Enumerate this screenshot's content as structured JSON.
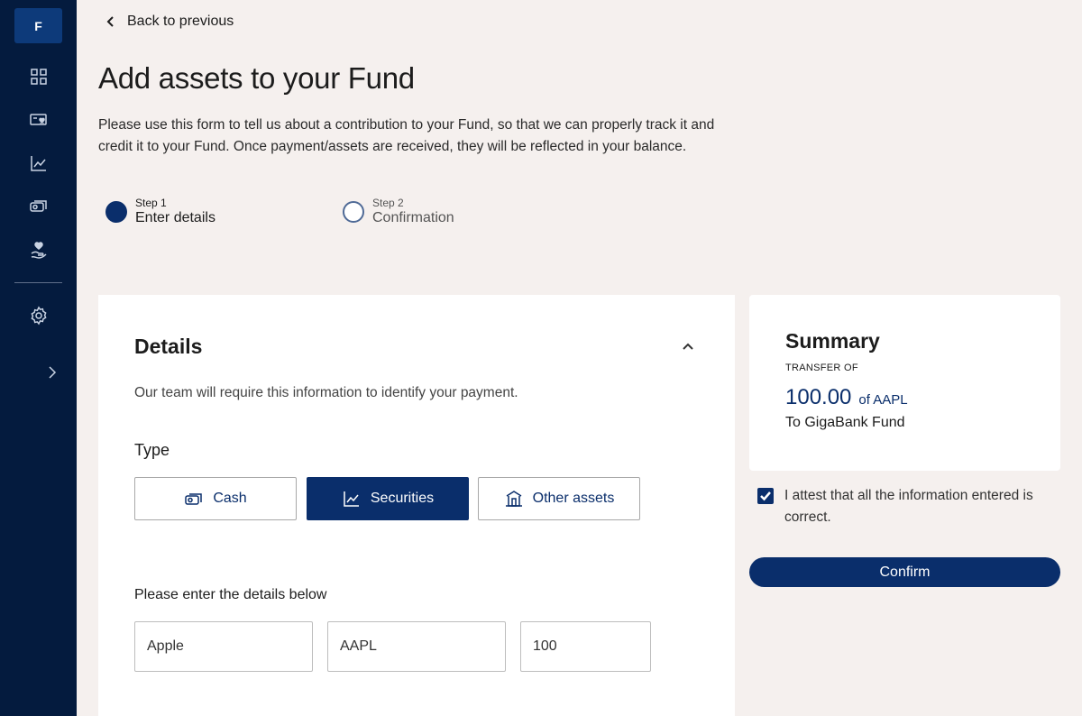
{
  "sidebar": {
    "logo_letter": "F",
    "items": [
      {
        "icon": "dashboard-grid-icon"
      },
      {
        "icon": "card-heart-icon"
      },
      {
        "icon": "chart-line-icon"
      },
      {
        "icon": "cash-icon"
      },
      {
        "icon": "hand-heart-icon"
      }
    ],
    "settings_icon": "gear-icon",
    "expand_icon": "chevron-right-icon"
  },
  "nav": {
    "back_label": "Back to previous"
  },
  "page": {
    "title": "Add assets to your Fund",
    "intro": "Please use this form to tell us about a contribution to your Fund, so that we can properly track it and credit it to your Fund. Once payment/assets are received, they will be reflected in your balance."
  },
  "steps": [
    {
      "small": "Step 1",
      "label": "Enter details",
      "state": "active"
    },
    {
      "small": "Step 2",
      "label": "Confirmation",
      "state": "inactive"
    }
  ],
  "details": {
    "title": "Details",
    "description": "Our team will require this information to identify your payment.",
    "type_label": "Type",
    "types": [
      {
        "label": "Cash",
        "icon": "cash-icon",
        "selected": false
      },
      {
        "label": "Securities",
        "icon": "chart-line-icon",
        "selected": true
      },
      {
        "label": "Other assets",
        "icon": "bank-building-icon",
        "selected": false
      }
    ],
    "enter_label": "Please enter the details below",
    "fields": [
      {
        "value": "Apple"
      },
      {
        "value": "AAPL"
      },
      {
        "value": "100"
      }
    ]
  },
  "summary": {
    "title": "Summary",
    "subtitle": "TRANSFER OF",
    "amount": "100.00",
    "of_label": "of AAPL",
    "to_label": "To GigaBank Fund"
  },
  "attest": {
    "checked": true,
    "text": "I attest that all the information entered is correct."
  },
  "confirm_label": "Confirm",
  "colors": {
    "sidebar": "#041b3e",
    "accent": "#0a2e6b",
    "background": "#f5f0ee"
  }
}
